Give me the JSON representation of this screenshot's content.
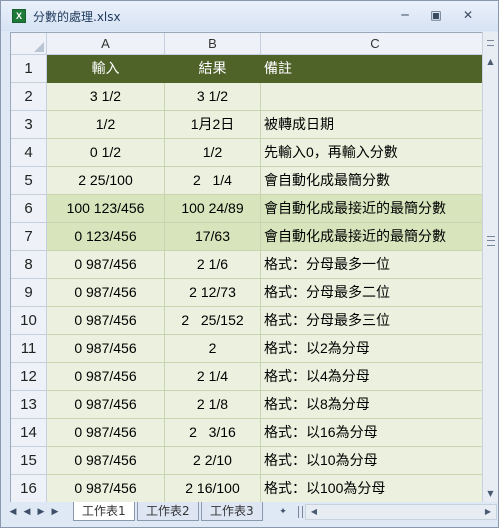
{
  "window": {
    "title": "分數的處理.xlsx",
    "app_icon_letter": "X",
    "minimize_icon": "minimize-icon",
    "restore_icon": "restore-icon",
    "close_icon": "close-icon"
  },
  "columns": [
    "A",
    "B",
    "C"
  ],
  "rows": [
    {
      "num": "1",
      "a": "輸入",
      "b": "結果",
      "c": "備註",
      "style": "header"
    },
    {
      "num": "2",
      "a": "3 1/2",
      "b": "3 1/2",
      "c": "",
      "style": "light"
    },
    {
      "num": "3",
      "a": "1/2",
      "b": "1月2日",
      "c": "被轉成日期",
      "style": "light"
    },
    {
      "num": "4",
      "a": "0 1/2",
      "b": "1/2",
      "c": "先輸入0，再輸入分數",
      "style": "light"
    },
    {
      "num": "5",
      "a": "2 25/100",
      "b": "2   1/4",
      "c": "會自動化成最簡分數",
      "style": "light"
    },
    {
      "num": "6",
      "a": "100 123/456",
      "b": "100 24/89",
      "c": "會自動化成最接近的最簡分數",
      "style": "highlight"
    },
    {
      "num": "7",
      "a": "0 123/456",
      "b": "17/63",
      "c": "會自動化成最接近的最簡分數",
      "style": "highlight"
    },
    {
      "num": "8",
      "a": "0 987/456",
      "b": "2 1/6",
      "c": "格式：分母最多一位",
      "style": "light"
    },
    {
      "num": "9",
      "a": "0 987/456",
      "b": "2 12/73",
      "c": "格式：分母最多二位",
      "style": "light"
    },
    {
      "num": "10",
      "a": "0 987/456",
      "b": "2   25/152",
      "c": "格式：分母最多三位",
      "style": "light"
    },
    {
      "num": "11",
      "a": "0 987/456",
      "b": "2",
      "c": "格式：以2為分母",
      "style": "light"
    },
    {
      "num": "12",
      "a": "0 987/456",
      "b": "2 1/4",
      "c": "格式：以4為分母",
      "style": "light"
    },
    {
      "num": "13",
      "a": "0 987/456",
      "b": "2 1/8",
      "c": "格式：以8為分母",
      "style": "light"
    },
    {
      "num": "14",
      "a": "0 987/456",
      "b": "2   3/16",
      "c": "格式：以16為分母",
      "style": "light"
    },
    {
      "num": "15",
      "a": "0 987/456",
      "b": "2 2/10",
      "c": "格式：以10為分母",
      "style": "light"
    },
    {
      "num": "16",
      "a": "0 987/456",
      "b": "2 16/100",
      "c": "格式：以100為分母",
      "style": "light"
    }
  ],
  "sheet_tabs": [
    {
      "label": "工作表1",
      "active": true
    },
    {
      "label": "工作表2",
      "active": false
    },
    {
      "label": "工作表3",
      "active": false
    }
  ],
  "colors": {
    "header_fill": "#4f6228",
    "highlight_fill": "#d7e4bc",
    "light_fill": "#ebf1de"
  }
}
